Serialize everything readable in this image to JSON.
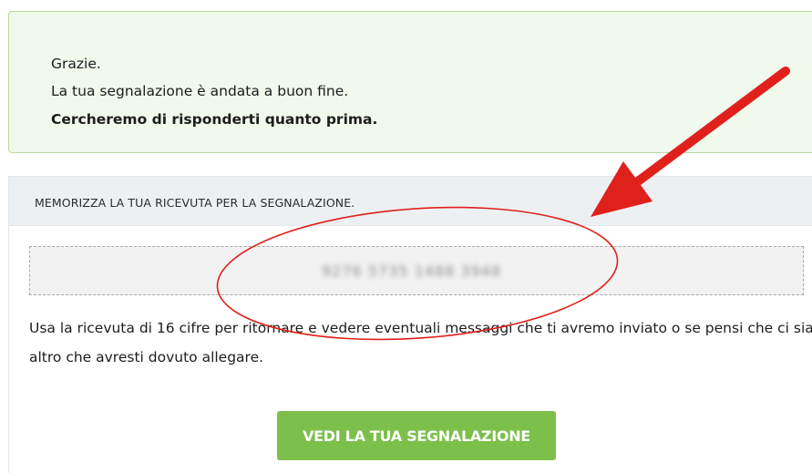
{
  "success": {
    "line1": "Grazie.",
    "line2": "La tua segnalazione è andata a buon fine.",
    "line3": "Cercheremo di risponderti quanto prima."
  },
  "receipt": {
    "header": "MEMORIZZA LA TUA RICEVUTA PER LA SEGNALAZIONE.",
    "code": "9276 5735 1488 3948",
    "info": "Usa la ricevuta di 16 cifre per ritornare e vedere eventuali messaggi che ti avremo inviato o se pensi che ci sia altro che avresti dovuto allegare.",
    "button_label": "VEDI LA TUA SEGNALAZIONE"
  },
  "colors": {
    "success_bg": "#f1f8ec",
    "success_border": "#b9d89c",
    "button": "#7cbf4a",
    "annotation": "#e0201b"
  }
}
